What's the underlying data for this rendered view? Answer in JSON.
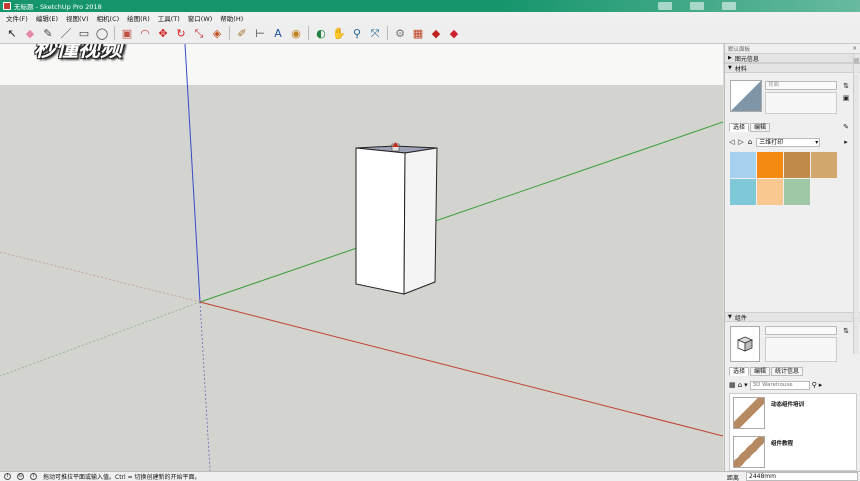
{
  "window": {
    "title": "无标题 - SketchUp Pro 2018"
  },
  "menu": [
    "文件(F)",
    "编辑(E)",
    "视图(V)",
    "相机(C)",
    "绘图(R)",
    "工具(T)",
    "窗口(W)",
    "帮助(H)"
  ],
  "watermark": "秒懂视频",
  "toolbar": [
    {
      "name": "select-tool-icon",
      "glyph": "↖",
      "color": "#222"
    },
    {
      "name": "eraser-tool-icon",
      "glyph": "◆",
      "color": "#e58aa6"
    },
    {
      "name": "pencil-tool-icon",
      "glyph": "✎",
      "color": "#444"
    },
    {
      "name": "line-tool-icon",
      "glyph": "／",
      "color": "#444"
    },
    {
      "name": "rectangle-tool-icon",
      "glyph": "▭",
      "color": "#444"
    },
    {
      "name": "circle-tool-icon",
      "glyph": "◯",
      "color": "#444"
    },
    {
      "name": "pushpull-tool-icon",
      "glyph": "▣",
      "color": "#c05040"
    },
    {
      "name": "arc-tool-icon",
      "glyph": "◠",
      "color": "#c04040"
    },
    {
      "name": "move-tool-icon",
      "glyph": "✥",
      "color": "#d02020"
    },
    {
      "name": "rotate-tool-icon",
      "glyph": "↻",
      "color": "#d02020"
    },
    {
      "name": "scale-tool-icon",
      "glyph": "⤡",
      "color": "#c03030"
    },
    {
      "name": "offset-tool-icon",
      "glyph": "◈",
      "color": "#c05020"
    },
    {
      "name": "tape-measure-icon",
      "glyph": "✐",
      "color": "#a07020"
    },
    {
      "name": "dimension-tool-icon",
      "glyph": "⊢",
      "color": "#444"
    },
    {
      "name": "text-tool-icon",
      "glyph": "A",
      "color": "#2050a0"
    },
    {
      "name": "paint-bucket-icon",
      "glyph": "◉",
      "color": "#c08020"
    },
    {
      "name": "orbit-tool-icon",
      "glyph": "◐",
      "color": "#208040"
    },
    {
      "name": "pan-tool-icon",
      "glyph": "✋",
      "color": "#c09040"
    },
    {
      "name": "zoom-tool-icon",
      "glyph": "⚲",
      "color": "#206090"
    },
    {
      "name": "zoom-extents-icon",
      "glyph": "⤧",
      "color": "#206090"
    },
    {
      "name": "warehouse-icon",
      "glyph": "⚙",
      "color": "#777"
    },
    {
      "name": "component-icon",
      "glyph": "▦",
      "color": "#c04020"
    },
    {
      "name": "extension-icon",
      "glyph": "◆",
      "color": "#c02020"
    },
    {
      "name": "ruby-icon",
      "glyph": "◆",
      "color": "#d02030"
    }
  ],
  "tray": {
    "title": "默认面板",
    "panels": {
      "entity_info": "图元信息",
      "materials": "材料",
      "components": "组件"
    },
    "materials": {
      "name_placeholder": "背面",
      "tabs": [
        "选择",
        "编辑"
      ],
      "library": "三维打印",
      "swatches": [
        "#a7cfee",
        "#f58a12",
        "#c08a4a",
        "#d3a86e",
        "#7ec8d8",
        "#f8c890",
        "#9fc8a8"
      ]
    },
    "components": {
      "tabs": [
        "选择",
        "编辑",
        "统计信息"
      ],
      "search_placeholder": "3D Warehouse",
      "results": [
        "动态组件培训",
        "组件教程"
      ]
    }
  },
  "status": {
    "message": "拖动可推拉平面或输入值。Ctrl = 切换创建新的开始平面。",
    "measure_label": "距离",
    "measure_value": "2448mm"
  },
  "colors": {
    "title_bar": "#16956d",
    "axis_red": "#c04030",
    "axis_green": "#30a030",
    "axis_blue": "#3040c0"
  }
}
